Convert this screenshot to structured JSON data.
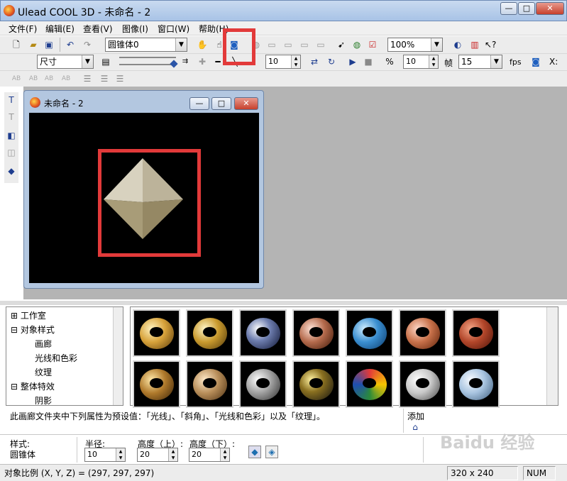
{
  "window": {
    "title": "Ulead COOL 3D - 未命名 - 2",
    "min_label": "—",
    "max_label": "□",
    "close_label": "✕"
  },
  "menu": [
    "文件(F)",
    "编辑(E)",
    "查看(V)",
    "图像(I)",
    "窗口(W)",
    "帮助(H)"
  ],
  "toolbar1": {
    "object_select": "圆锥体0",
    "zoom": "100%"
  },
  "toolbar2": {
    "size_mode": "尺寸",
    "value1": "10",
    "value2": "10",
    "frame_label": "帧",
    "frames": "15",
    "fps_label": "fps",
    "x_label": "X:"
  },
  "document": {
    "title": "未命名 - 2"
  },
  "tree": {
    "items": [
      "工作室",
      "对象样式",
      "画廊",
      "光线和色彩",
      "纹理",
      "整体特效",
      "阴影"
    ]
  },
  "gallery": {
    "description": "此画廊文件夹中下列属性为预设值：「光线」、「斜角」、「光线和色彩」以及「纹理」。",
    "add_label": "添加"
  },
  "props": {
    "style_label": "样式:",
    "style_value": "圆锥体",
    "radius_label": "半径:",
    "radius_value": "10",
    "height_top_label": "高度（上）:",
    "height_top_value": "20",
    "height_bottom_label": "高度（下）:",
    "height_bottom_value": "20"
  },
  "statusbar": {
    "scale": "对象比例 (X, Y, Z) = (297, 297, 297)",
    "resolution": "320 x 240",
    "num": "NUM"
  },
  "watermark": "Baidu 经验",
  "colors": {
    "highlight": "#e23a3a",
    "canvas": "#000000",
    "workspace": "#b4b4b4"
  }
}
